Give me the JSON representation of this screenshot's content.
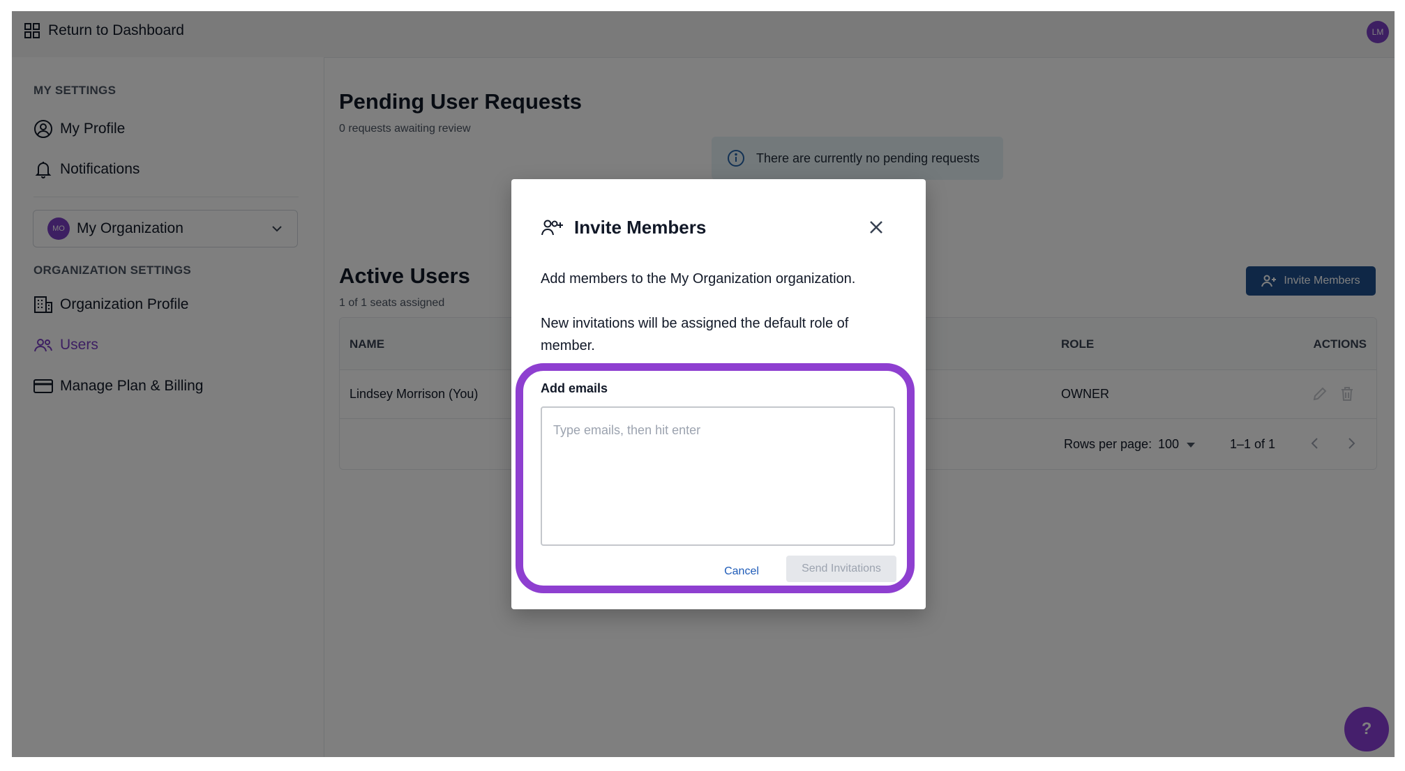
{
  "topbar": {
    "return_label": "Return to Dashboard",
    "user_initials": "LM"
  },
  "sidebar": {
    "my_settings_label": "MY SETTINGS",
    "my_profile": "My Profile",
    "notifications": "Notifications",
    "org_initials": "MO",
    "org_name": "My Organization",
    "org_settings_label": "ORGANIZATION SETTINGS",
    "org_profile": "Organization Profile",
    "users": "Users",
    "billing": "Manage Plan & Billing"
  },
  "pending": {
    "title": "Pending User Requests",
    "subtitle": "0 requests awaiting review",
    "banner": "There are currently no pending requests"
  },
  "active": {
    "title": "Active Users",
    "subtitle": "1 of 1 seats assigned",
    "invite_button": "Invite Members",
    "columns": {
      "name": "NAME",
      "role": "ROLE",
      "actions": "ACTIONS"
    },
    "rows": [
      {
        "name": "Lindsey Morrison (You)",
        "role": "OWNER"
      }
    ],
    "footer": {
      "rows_per_page_label": "Rows per page:",
      "rows_per_page_value": "100",
      "range": "1–1 of 1"
    }
  },
  "help_label": "?",
  "modal": {
    "title": "Invite Members",
    "line1": "Add members to the My Organization organization.",
    "line2": "New invitations will be assigned the default role of member.",
    "emails_label": "Add emails",
    "emails_placeholder": "Type emails, then hit enter",
    "cancel": "Cancel",
    "send": "Send Invitations"
  },
  "colors": {
    "accent": "#7b3fc4",
    "primary_button": "#1e4f8c",
    "highlight": "#8e3fd0",
    "banner": "#e6f3f7"
  }
}
